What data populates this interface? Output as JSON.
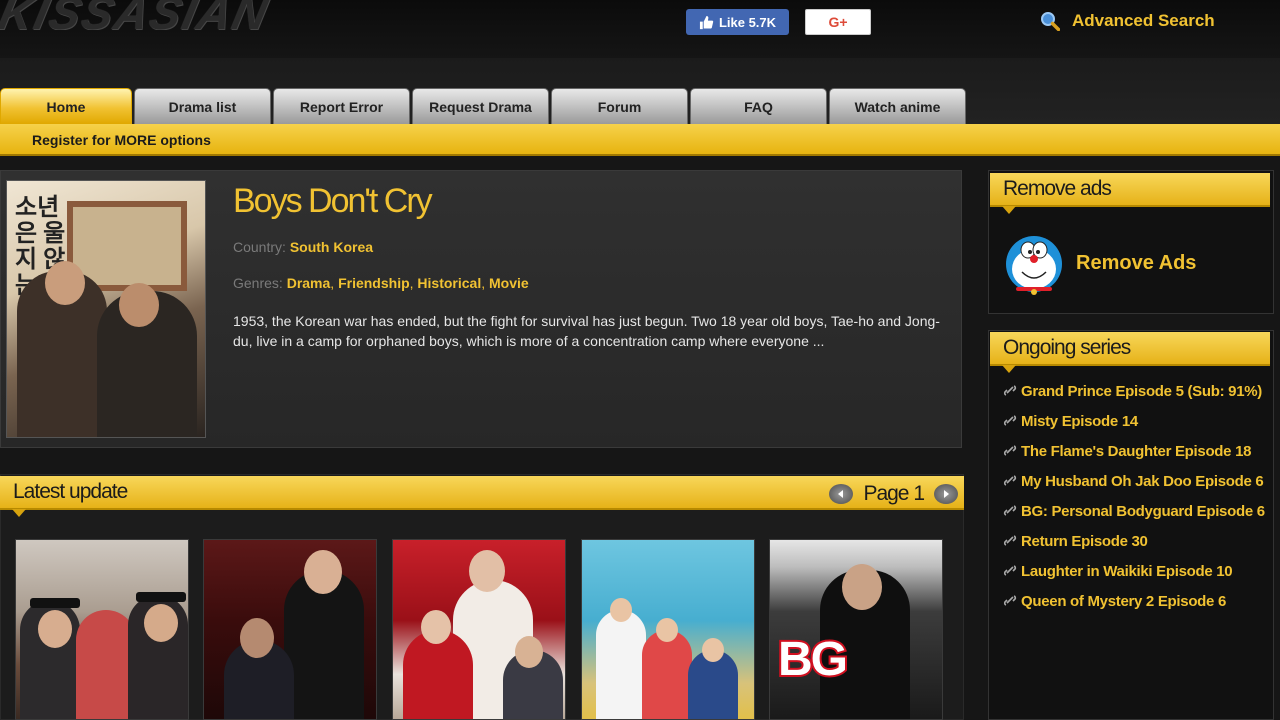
{
  "header": {
    "logo_text": "KISSASIAN",
    "fb_like_label": "Like 5.7K",
    "gplus_label": "G+",
    "advanced_search_label": "Advanced Search"
  },
  "nav": {
    "tabs": [
      {
        "label": "Home",
        "active": true
      },
      {
        "label": "Drama list",
        "active": false
      },
      {
        "label": "Report Error",
        "active": false
      },
      {
        "label": "Request Drama",
        "active": false
      },
      {
        "label": "Forum",
        "active": false
      },
      {
        "label": "FAQ",
        "active": false
      },
      {
        "label": "Watch anime",
        "active": false
      }
    ],
    "register_label": "Register for MORE options"
  },
  "featured": {
    "title": "Boys Don't Cry",
    "country_label": "Country:",
    "country": "South Korea",
    "genres_label": "Genres:",
    "genres": [
      "Drama",
      "Friendship",
      "Historical",
      "Movie"
    ],
    "synopsis": "1953, the Korean war has ended, but the fight for survival has just begun. Two 18 year old boys, Tae-ho and Jong-du, live in a camp for orphaned boys, which is more of a concentration camp where everyone ...",
    "poster_text": "소년은 울지 않는다"
  },
  "latest_update": {
    "heading": "Latest update",
    "page_label": "Page 1",
    "thumb_text": "BG"
  },
  "sidebar": {
    "remove_ads_heading": "Remove ads",
    "remove_ads_link": "Remove Ads",
    "ongoing_heading": "Ongoing series",
    "ongoing": [
      "Grand Prince Episode 5 (Sub: 91%)",
      "Misty Episode 14",
      "The Flame's Daughter Episode 18",
      "My Husband Oh Jak Doo Episode 6",
      "BG: Personal Bodyguard Episode 6",
      "Return Episode 30",
      "Laughter in Waikiki Episode 10",
      "Queen of Mystery 2 Episode 6"
    ]
  },
  "colors": {
    "accent": "#f1c232",
    "background": "#161616",
    "fb_blue": "#4267b2",
    "gplus_red": "#dd4b39"
  }
}
